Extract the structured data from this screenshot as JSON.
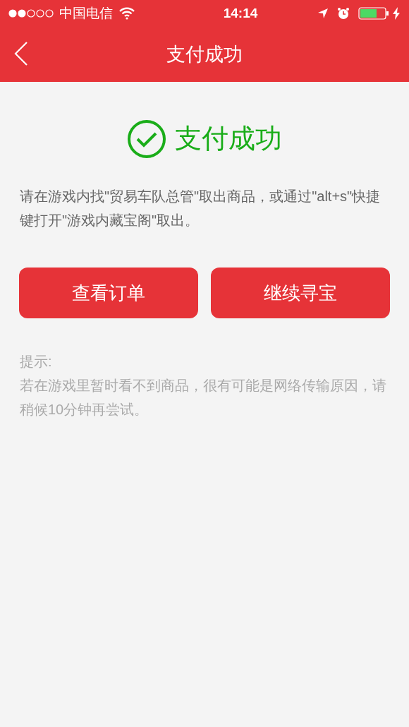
{
  "status_bar": {
    "carrier": "中国电信",
    "time": "14:14"
  },
  "nav": {
    "title": "支付成功"
  },
  "result": {
    "title": "支付成功",
    "message": "请在游戏内找\"贸易车队总管\"取出商品，或通过\"alt+s\"快捷键打开\"游戏内藏宝阁\"取出。"
  },
  "buttons": [
    "查看订单",
    "继续寻宝"
  ],
  "tip": {
    "label": "提示:",
    "text": "若在游戏里暂时看不到商品，很有可能是网络传输原因，请稍候10分钟再尝试。"
  }
}
